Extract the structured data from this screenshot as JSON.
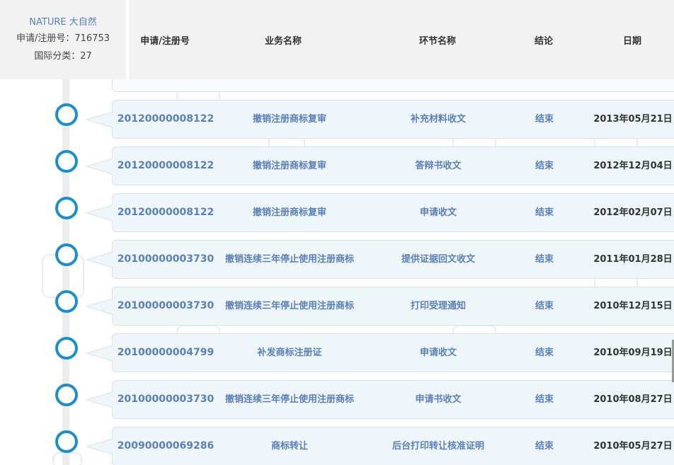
{
  "mark": {
    "name": "NATURE 大自然",
    "reg_no": "申请/注册号：716753",
    "class": "国际分类：27"
  },
  "header": {
    "reg_no": "申请/注册号",
    "business": "业务名称",
    "step": "环节名称",
    "result": "结论",
    "date": "日期"
  },
  "rows": [
    {
      "reg_no": "20120000008122",
      "business": "撤销注册商标复审",
      "step": "补充材料收文",
      "result": "结束",
      "date": "2013年05月21日"
    },
    {
      "reg_no": "20120000008122",
      "business": "撤销注册商标复审",
      "step": "答辩书收文",
      "result": "结束",
      "date": "2012年12月04日"
    },
    {
      "reg_no": "20120000008122",
      "business": "撤销注册商标复审",
      "step": "申请收文",
      "result": "结束",
      "date": "2012年02月07日"
    },
    {
      "reg_no": "20100000003730",
      "business": "撤销连续三年停止使用注册商标",
      "step": "提供证据回文收文",
      "result": "结束",
      "date": "2011年01月28日"
    },
    {
      "reg_no": "20100000003730",
      "business": "撤销连续三年停止使用注册商标",
      "step": "打印受理通知",
      "result": "结束",
      "date": "2010年12月15日"
    },
    {
      "reg_no": "20100000004799",
      "business": "补发商标注册证",
      "step": "申请收文",
      "result": "结束",
      "date": "2010年09月19日"
    },
    {
      "reg_no": "20100000003730",
      "business": "撤销连续三年停止使用注册商标",
      "step": "申请书收文",
      "result": "结束",
      "date": "2010年08月27日"
    },
    {
      "reg_no": "20090000069286",
      "business": "商标转让",
      "step": "后台打印转让核准证明",
      "result": "结束",
      "date": "2010年05月27日"
    }
  ],
  "colors": {
    "accent": "#1e8fc6",
    "link": "#5b7fb8",
    "row_bg": "#eef6fa"
  }
}
